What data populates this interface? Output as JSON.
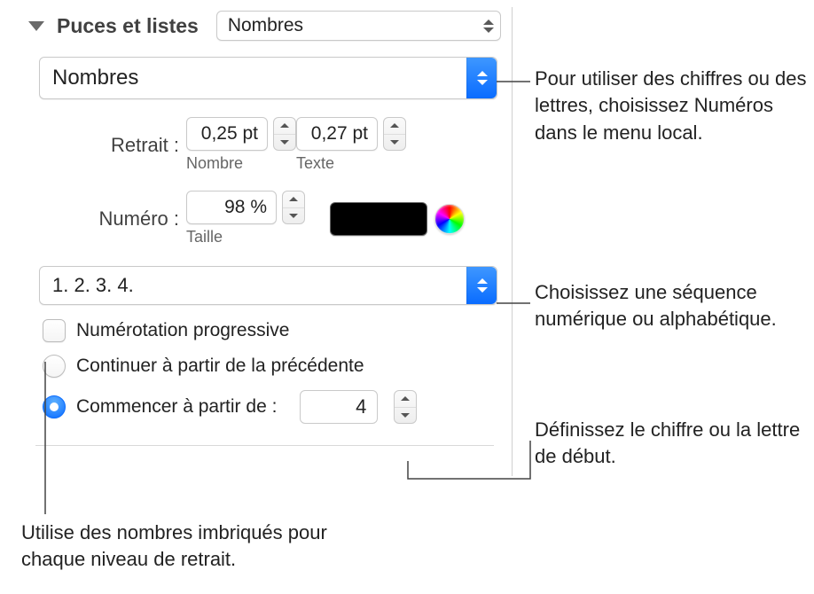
{
  "section_title": "Puces et listes",
  "list_style": "Nombres",
  "bullet_style": "Nombres",
  "retrait": {
    "label": "Retrait :",
    "nombre_value": "0,25 pt",
    "nombre_sub": "Nombre",
    "texte_value": "0,27 pt",
    "texte_sub": "Texte"
  },
  "numero": {
    "label": "Numéro :",
    "taille_value": "98 %",
    "taille_sub": "Taille"
  },
  "sequence": "1. 2. 3. 4.",
  "checkbox_label": "Numérotation progressive",
  "radio_continue": "Continuer à partir de la précédente",
  "radio_start": "Commencer à partir de :",
  "start_value": "4",
  "callouts": {
    "c1": "Pour utiliser des chiffres ou des lettres, choisissez Numéros dans le menu local.",
    "c2": "Choisissez une séquence numérique ou alphabétique.",
    "c3": "Définissez le chiffre ou la lettre de début.",
    "c4": "Utilise des nombres imbriqués pour chaque niveau de retrait."
  }
}
